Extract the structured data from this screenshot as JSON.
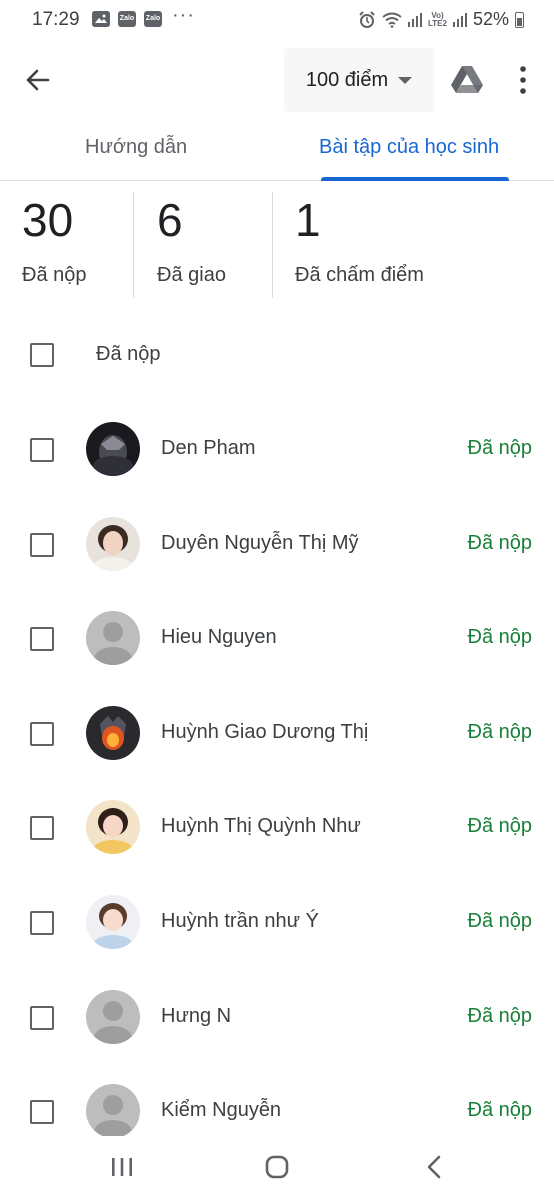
{
  "status_bar": {
    "time": "17:29",
    "notif_icons": [
      "gallery-icon",
      "zalo-icon",
      "zalo-icon"
    ],
    "zalo_label": "Zalo",
    "more": "···",
    "lte_label_1": "Vo)",
    "lte_label_2": "LTE2",
    "battery": "52%"
  },
  "app_bar": {
    "points_label": "100 điểm"
  },
  "tabs": [
    {
      "label": "Hướng dẫn",
      "active": false
    },
    {
      "label": "Bài tập của học sinh",
      "active": true
    }
  ],
  "stats": [
    {
      "value": "30",
      "label": "Đã nộp"
    },
    {
      "value": "6",
      "label": "Đã giao"
    },
    {
      "value": "1",
      "label": "Đã chấm điểm"
    }
  ],
  "list": {
    "filter_label": "Đã nộp",
    "students": [
      {
        "name": "Den Pham",
        "status": "Đã nộp",
        "avatar": "photo-dark"
      },
      {
        "name": "Duyên Nguyễn Thị Mỹ",
        "status": "Đã nộp",
        "avatar": "photo-girl"
      },
      {
        "name": "Hieu Nguyen",
        "status": "Đã nộp",
        "avatar": "default-person"
      },
      {
        "name": "Huỳnh Giao Dương Thị",
        "status": "Đã nộp",
        "avatar": "photo-fire"
      },
      {
        "name": "Huỳnh Thị Quỳnh Như",
        "status": "Đã nộp",
        "avatar": "photo-girl-yellow"
      },
      {
        "name": "Huỳnh trần như Ý",
        "status": "Đã nộp",
        "avatar": "photo-child"
      },
      {
        "name": "Hưng N",
        "status": "Đã nộp",
        "avatar": "default-person"
      },
      {
        "name": "Kiểm Nguyễn",
        "status": "Đã nộp",
        "avatar": "default-person"
      }
    ]
  },
  "colors": {
    "accent": "#1967d2",
    "status_green": "#188038"
  }
}
